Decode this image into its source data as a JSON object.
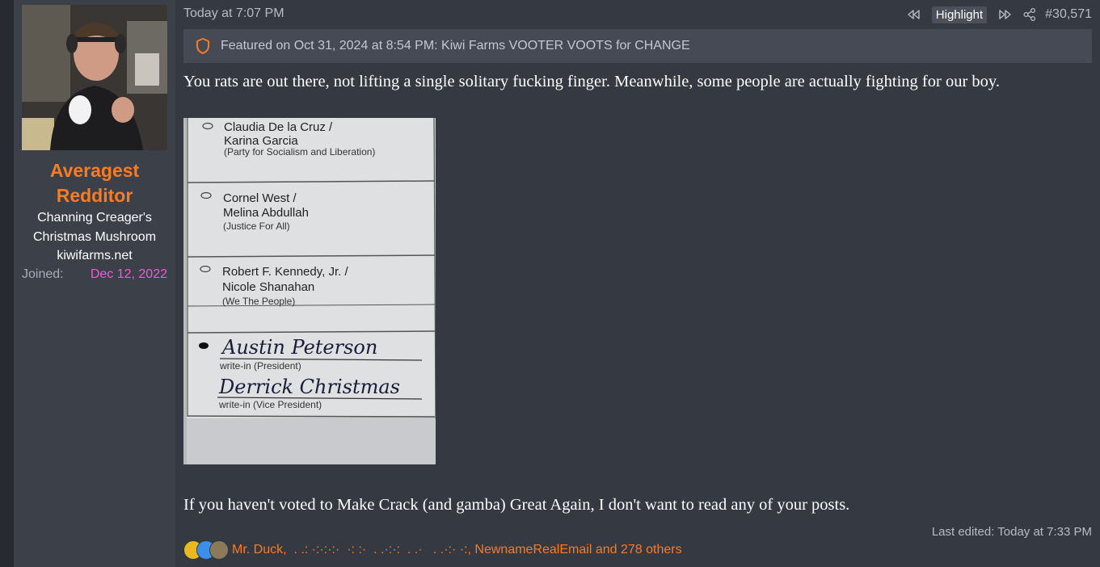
{
  "user": {
    "name": "Averagest Redditor",
    "title_lines": [
      "Channing Creager's",
      "Christmas Mushroom",
      "kiwifarms.net"
    ],
    "joined_label": "Joined:",
    "joined_date": "Dec 12, 2022"
  },
  "post": {
    "date": "Today at 7:07 PM",
    "highlight_label": "Highlight",
    "post_number": "#30,571",
    "featured_text": "Featured on Oct 31, 2024 at 8:54 PM: Kiwi Farms VOOTER VOOTS for CHANGE",
    "line1": "You rats are out there, not lifting a single solitary fucking finger. Meanwhile, some people are actually fighting for our boy.",
    "line2": "If you haven't voted to Make Crack (and gamba) Great Again, I don't want to read any of your posts.",
    "last_edited": "Last edited: Today at 7:33 PM",
    "reactions_text": "Mr. Duck,  . .: ·:·:·:·  ·: :·  . .·:·:  . .·   . .·:· ·:, NewnameRealEmail and 278 others"
  },
  "ballot": {
    "candidates": [
      {
        "names": "Claudia De la Cruz /",
        "names2": "Karina Garcia",
        "party": "(Party for Socialism and Liberation)"
      },
      {
        "names": "Cornel West /",
        "names2": "Melina Abdullah",
        "party": "(Justice For All)"
      },
      {
        "names": "Robert F. Kennedy, Jr. /",
        "names2": "Nicole Shanahan",
        "party": "(We The People)"
      }
    ],
    "writein_president": "Austin Peterson",
    "writein_president_label": "write-in (President)",
    "writein_vp": "Derrick Christmas",
    "writein_vp_label": "write-in (Vice President)"
  },
  "colors": {
    "accent": "#f97b23",
    "joined_date": "#ee5bd6",
    "post_bg": "#353942",
    "user_bg": "#3c4049"
  },
  "icons": [
    "shield-icon",
    "rewind-icon",
    "fast-forward-icon",
    "share-icon"
  ]
}
